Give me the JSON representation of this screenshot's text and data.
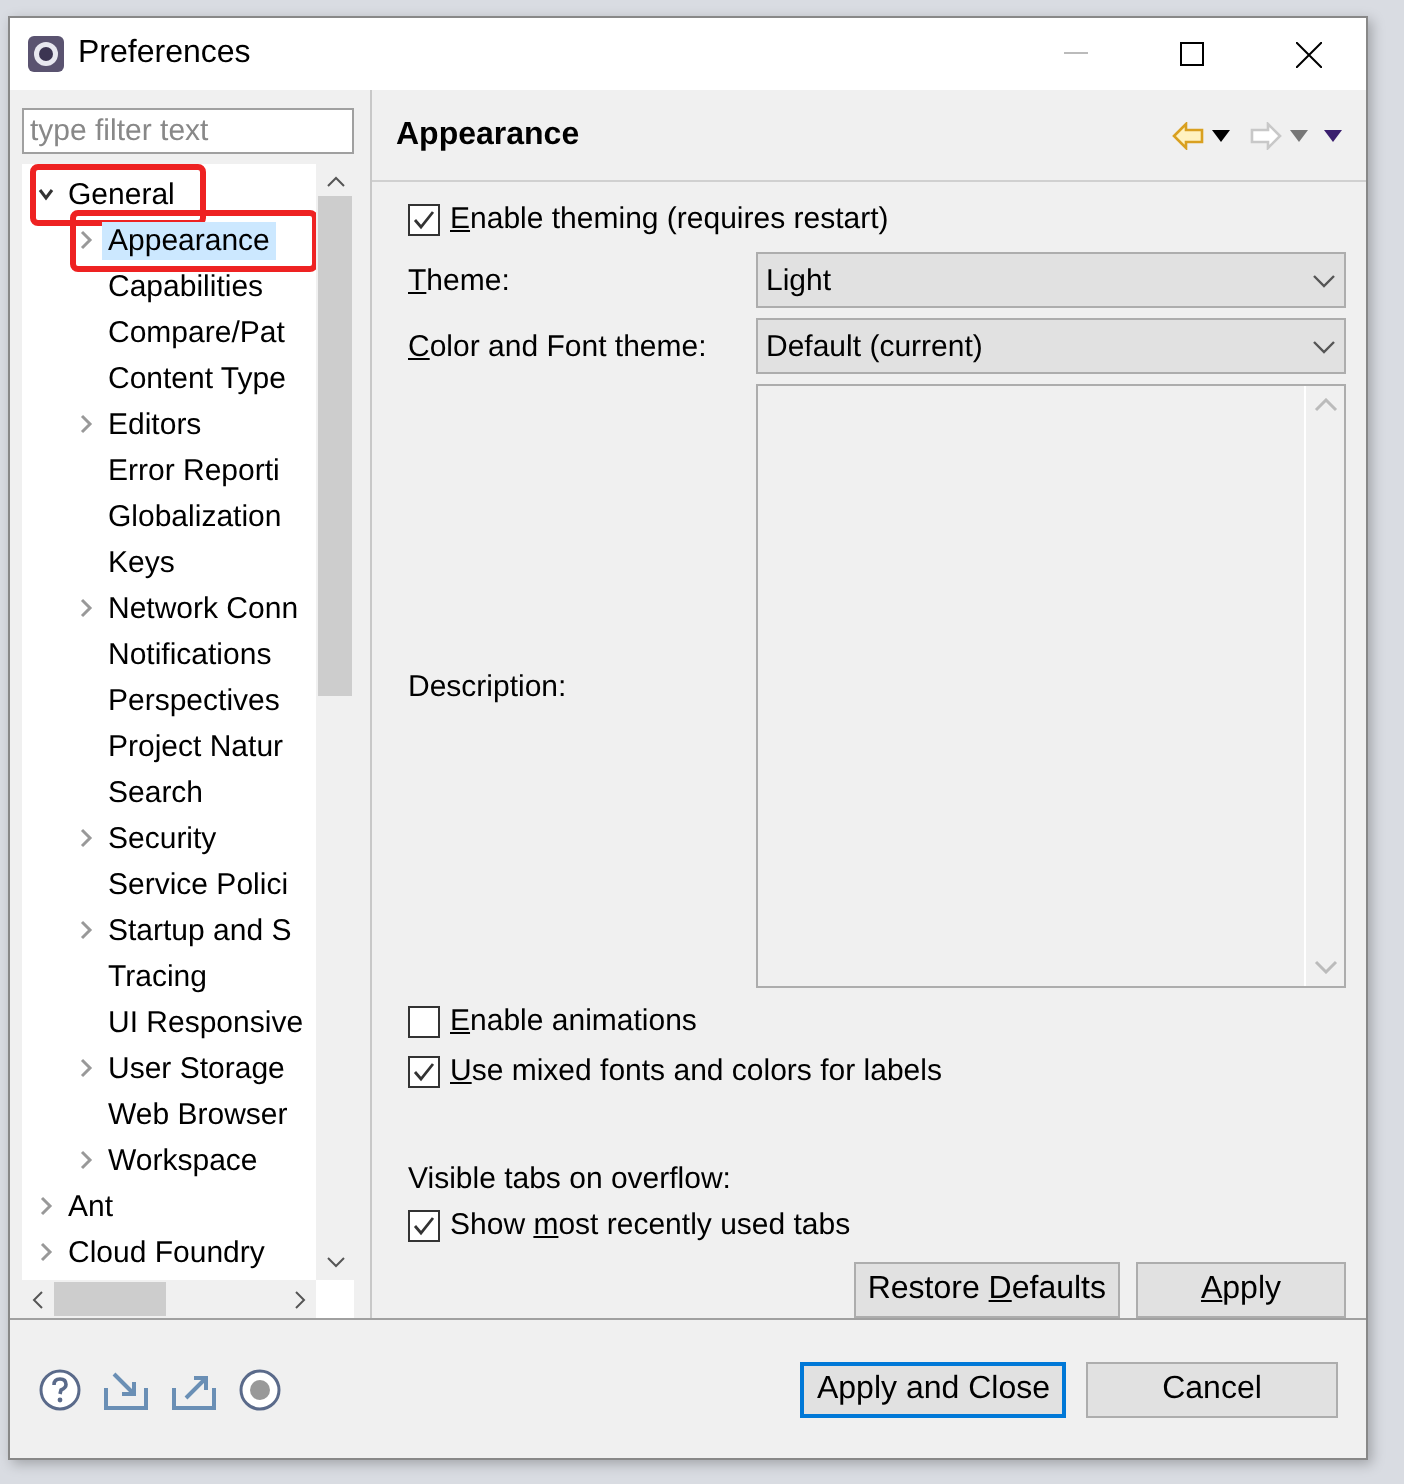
{
  "window": {
    "title": "Preferences",
    "minimize_enabled": false
  },
  "filter": {
    "placeholder": "type filter text"
  },
  "tree": [
    {
      "label": "General",
      "expanded": true,
      "selected": false,
      "annotated": true,
      "children": [
        {
          "label": "Appearance",
          "expanded": false,
          "selected": true,
          "annotated": true
        },
        {
          "label": "Capabilities",
          "selected": false,
          "annotated": false
        },
        {
          "label": "Compare/Pat",
          "selected": false,
          "annotated": false
        },
        {
          "label": "Content Type",
          "selected": false,
          "annotated": false
        },
        {
          "label": "Editors",
          "expanded": false,
          "selected": false,
          "annotated": false
        },
        {
          "label": "Error Reporti",
          "selected": false,
          "annotated": false
        },
        {
          "label": "Globalization",
          "selected": false,
          "annotated": false
        },
        {
          "label": "Keys",
          "selected": false,
          "annotated": false
        },
        {
          "label": "Network Conn",
          "expanded": false,
          "selected": false,
          "annotated": false
        },
        {
          "label": "Notifications",
          "selected": false,
          "annotated": false
        },
        {
          "label": "Perspectives",
          "selected": false,
          "annotated": false
        },
        {
          "label": "Project Natur",
          "selected": false,
          "annotated": false
        },
        {
          "label": "Search",
          "selected": false,
          "annotated": false
        },
        {
          "label": "Security",
          "expanded": false,
          "selected": false,
          "annotated": false
        },
        {
          "label": "Service Polici",
          "selected": false,
          "annotated": false
        },
        {
          "label": "Startup and S",
          "expanded": false,
          "selected": false,
          "annotated": false
        },
        {
          "label": "Tracing",
          "selected": false,
          "annotated": false
        },
        {
          "label": "UI Responsive",
          "selected": false,
          "annotated": false
        },
        {
          "label": "User Storage",
          "expanded": false,
          "selected": false,
          "annotated": false
        },
        {
          "label": "Web Browser",
          "selected": false,
          "annotated": false
        },
        {
          "label": "Workspace",
          "expanded": false,
          "selected": false,
          "annotated": false
        }
      ]
    },
    {
      "label": "Ant",
      "expanded": false,
      "selected": false,
      "annotated": false
    },
    {
      "label": "Cloud Foundry",
      "expanded": false,
      "selected": false,
      "annotated": false
    }
  ],
  "page": {
    "title": "Appearance",
    "back_enabled": true,
    "forward_enabled": false
  },
  "theming": {
    "label": {
      "key": "E",
      "post": "nable theming (requires restart)"
    },
    "checked": true
  },
  "selects": [
    {
      "label": {
        "key": "T",
        "post": "heme:"
      },
      "value": "Light"
    },
    {
      "label": {
        "key": "C",
        "post": "olor and Font theme:"
      },
      "value": "Default (current)"
    }
  ],
  "description": {
    "label": "Description:"
  },
  "options": [
    {
      "label": {
        "key": "E",
        "post": "nable animations"
      },
      "checked": false
    },
    {
      "label": {
        "key": "U",
        "post": "se mixed fonts and colors for labels"
      },
      "checked": true
    }
  ],
  "overflow": {
    "heading": "Visible tabs on overflow:",
    "option": {
      "label": {
        "pre": "Show ",
        "key": "m",
        "post": "ost recently used tabs"
      },
      "checked": true
    }
  },
  "page_buttons": [
    {
      "label": {
        "pre": "Restore ",
        "key": "D",
        "post": "efaults"
      }
    },
    {
      "label": {
        "key": "A",
        "post": "pply"
      }
    }
  ],
  "dialog_buttons": [
    {
      "label": "Apply and Close",
      "default": true
    },
    {
      "label": "Cancel",
      "default": false
    }
  ]
}
